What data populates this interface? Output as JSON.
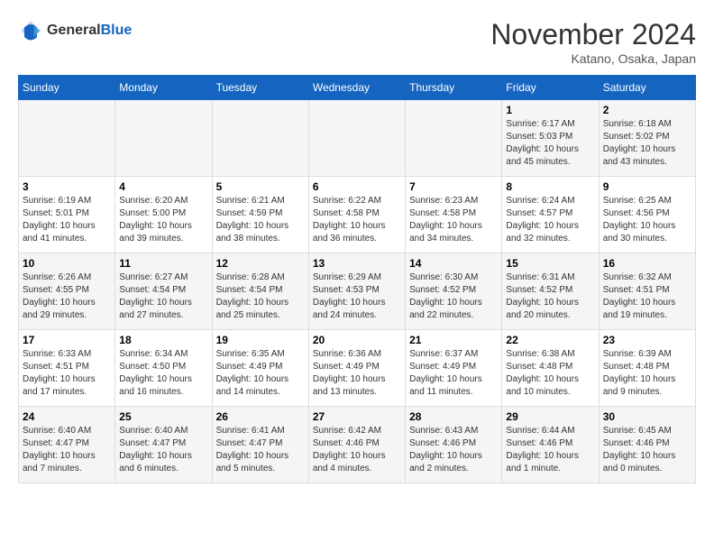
{
  "logo": {
    "text_general": "General",
    "text_blue": "Blue"
  },
  "header": {
    "month": "November 2024",
    "location": "Katano, Osaka, Japan"
  },
  "weekdays": [
    "Sunday",
    "Monday",
    "Tuesday",
    "Wednesday",
    "Thursday",
    "Friday",
    "Saturday"
  ],
  "weeks": [
    [
      {
        "day": "",
        "sunrise": "",
        "sunset": "",
        "daylight": ""
      },
      {
        "day": "",
        "sunrise": "",
        "sunset": "",
        "daylight": ""
      },
      {
        "day": "",
        "sunrise": "",
        "sunset": "",
        "daylight": ""
      },
      {
        "day": "",
        "sunrise": "",
        "sunset": "",
        "daylight": ""
      },
      {
        "day": "",
        "sunrise": "",
        "sunset": "",
        "daylight": ""
      },
      {
        "day": "1",
        "sunrise": "Sunrise: 6:17 AM",
        "sunset": "Sunset: 5:03 PM",
        "daylight": "Daylight: 10 hours and 45 minutes."
      },
      {
        "day": "2",
        "sunrise": "Sunrise: 6:18 AM",
        "sunset": "Sunset: 5:02 PM",
        "daylight": "Daylight: 10 hours and 43 minutes."
      }
    ],
    [
      {
        "day": "3",
        "sunrise": "Sunrise: 6:19 AM",
        "sunset": "Sunset: 5:01 PM",
        "daylight": "Daylight: 10 hours and 41 minutes."
      },
      {
        "day": "4",
        "sunrise": "Sunrise: 6:20 AM",
        "sunset": "Sunset: 5:00 PM",
        "daylight": "Daylight: 10 hours and 39 minutes."
      },
      {
        "day": "5",
        "sunrise": "Sunrise: 6:21 AM",
        "sunset": "Sunset: 4:59 PM",
        "daylight": "Daylight: 10 hours and 38 minutes."
      },
      {
        "day": "6",
        "sunrise": "Sunrise: 6:22 AM",
        "sunset": "Sunset: 4:58 PM",
        "daylight": "Daylight: 10 hours and 36 minutes."
      },
      {
        "day": "7",
        "sunrise": "Sunrise: 6:23 AM",
        "sunset": "Sunset: 4:58 PM",
        "daylight": "Daylight: 10 hours and 34 minutes."
      },
      {
        "day": "8",
        "sunrise": "Sunrise: 6:24 AM",
        "sunset": "Sunset: 4:57 PM",
        "daylight": "Daylight: 10 hours and 32 minutes."
      },
      {
        "day": "9",
        "sunrise": "Sunrise: 6:25 AM",
        "sunset": "Sunset: 4:56 PM",
        "daylight": "Daylight: 10 hours and 30 minutes."
      }
    ],
    [
      {
        "day": "10",
        "sunrise": "Sunrise: 6:26 AM",
        "sunset": "Sunset: 4:55 PM",
        "daylight": "Daylight: 10 hours and 29 minutes."
      },
      {
        "day": "11",
        "sunrise": "Sunrise: 6:27 AM",
        "sunset": "Sunset: 4:54 PM",
        "daylight": "Daylight: 10 hours and 27 minutes."
      },
      {
        "day": "12",
        "sunrise": "Sunrise: 6:28 AM",
        "sunset": "Sunset: 4:54 PM",
        "daylight": "Daylight: 10 hours and 25 minutes."
      },
      {
        "day": "13",
        "sunrise": "Sunrise: 6:29 AM",
        "sunset": "Sunset: 4:53 PM",
        "daylight": "Daylight: 10 hours and 24 minutes."
      },
      {
        "day": "14",
        "sunrise": "Sunrise: 6:30 AM",
        "sunset": "Sunset: 4:52 PM",
        "daylight": "Daylight: 10 hours and 22 minutes."
      },
      {
        "day": "15",
        "sunrise": "Sunrise: 6:31 AM",
        "sunset": "Sunset: 4:52 PM",
        "daylight": "Daylight: 10 hours and 20 minutes."
      },
      {
        "day": "16",
        "sunrise": "Sunrise: 6:32 AM",
        "sunset": "Sunset: 4:51 PM",
        "daylight": "Daylight: 10 hours and 19 minutes."
      }
    ],
    [
      {
        "day": "17",
        "sunrise": "Sunrise: 6:33 AM",
        "sunset": "Sunset: 4:51 PM",
        "daylight": "Daylight: 10 hours and 17 minutes."
      },
      {
        "day": "18",
        "sunrise": "Sunrise: 6:34 AM",
        "sunset": "Sunset: 4:50 PM",
        "daylight": "Daylight: 10 hours and 16 minutes."
      },
      {
        "day": "19",
        "sunrise": "Sunrise: 6:35 AM",
        "sunset": "Sunset: 4:49 PM",
        "daylight": "Daylight: 10 hours and 14 minutes."
      },
      {
        "day": "20",
        "sunrise": "Sunrise: 6:36 AM",
        "sunset": "Sunset: 4:49 PM",
        "daylight": "Daylight: 10 hours and 13 minutes."
      },
      {
        "day": "21",
        "sunrise": "Sunrise: 6:37 AM",
        "sunset": "Sunset: 4:49 PM",
        "daylight": "Daylight: 10 hours and 11 minutes."
      },
      {
        "day": "22",
        "sunrise": "Sunrise: 6:38 AM",
        "sunset": "Sunset: 4:48 PM",
        "daylight": "Daylight: 10 hours and 10 minutes."
      },
      {
        "day": "23",
        "sunrise": "Sunrise: 6:39 AM",
        "sunset": "Sunset: 4:48 PM",
        "daylight": "Daylight: 10 hours and 9 minutes."
      }
    ],
    [
      {
        "day": "24",
        "sunrise": "Sunrise: 6:40 AM",
        "sunset": "Sunset: 4:47 PM",
        "daylight": "Daylight: 10 hours and 7 minutes."
      },
      {
        "day": "25",
        "sunrise": "Sunrise: 6:40 AM",
        "sunset": "Sunset: 4:47 PM",
        "daylight": "Daylight: 10 hours and 6 minutes."
      },
      {
        "day": "26",
        "sunrise": "Sunrise: 6:41 AM",
        "sunset": "Sunset: 4:47 PM",
        "daylight": "Daylight: 10 hours and 5 minutes."
      },
      {
        "day": "27",
        "sunrise": "Sunrise: 6:42 AM",
        "sunset": "Sunset: 4:46 PM",
        "daylight": "Daylight: 10 hours and 4 minutes."
      },
      {
        "day": "28",
        "sunrise": "Sunrise: 6:43 AM",
        "sunset": "Sunset: 4:46 PM",
        "daylight": "Daylight: 10 hours and 2 minutes."
      },
      {
        "day": "29",
        "sunrise": "Sunrise: 6:44 AM",
        "sunset": "Sunset: 4:46 PM",
        "daylight": "Daylight: 10 hours and 1 minute."
      },
      {
        "day": "30",
        "sunrise": "Sunrise: 6:45 AM",
        "sunset": "Sunset: 4:46 PM",
        "daylight": "Daylight: 10 hours and 0 minutes."
      }
    ]
  ]
}
